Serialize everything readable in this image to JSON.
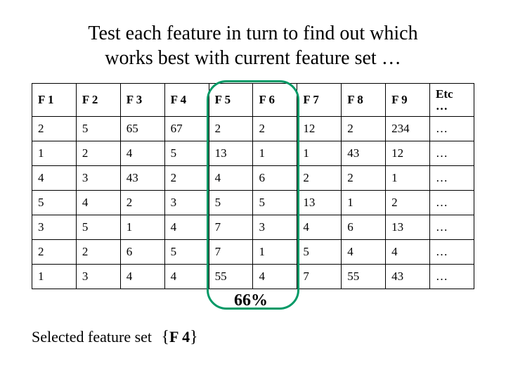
{
  "title_line1": "Test each feature in turn to find out which",
  "title_line2": "works best with current feature set …",
  "headers": [
    "F 1",
    "F 2",
    "F 3",
    "F 4",
    "F 5",
    "F 6",
    "F 7",
    "F 8",
    "F 9"
  ],
  "etc_label": "Etc",
  "etc_dots": "…",
  "rows": [
    [
      "2",
      "5",
      "65",
      "67",
      "2",
      "2",
      "12",
      "2",
      "234",
      "…"
    ],
    [
      "1",
      "2",
      "4",
      "5",
      "13",
      "1",
      "1",
      "43",
      "12",
      "…"
    ],
    [
      "4",
      "3",
      "43",
      "2",
      "4",
      "6",
      "2",
      "2",
      "1",
      "…"
    ],
    [
      "5",
      "4",
      "2",
      "3",
      "5",
      "5",
      "13",
      "1",
      "2",
      "…"
    ],
    [
      "3",
      "5",
      "1",
      "4",
      "7",
      "3",
      "4",
      "6",
      "13",
      "…"
    ],
    [
      "2",
      "2",
      "6",
      "5",
      "7",
      "1",
      "5",
      "4",
      "4",
      "…"
    ],
    [
      "1",
      "3",
      "4",
      "4",
      "55",
      "4",
      "7",
      "55",
      "43",
      "…"
    ]
  ],
  "percent_label": "66%",
  "selected_label": "Selected feature set",
  "selected_brace_open": "{",
  "selected_feature": "F 4",
  "selected_brace_close": "}",
  "chart_data": {
    "type": "table",
    "title": "Test each feature in turn to find out which works best with current feature set …",
    "columns": [
      "F 1",
      "F 2",
      "F 3",
      "F 4",
      "F 5",
      "F 6",
      "F 7",
      "F 8",
      "F 9",
      "Etc"
    ],
    "rows": [
      [
        2,
        5,
        65,
        67,
        2,
        2,
        12,
        2,
        234,
        null
      ],
      [
        1,
        2,
        4,
        5,
        13,
        1,
        1,
        43,
        12,
        null
      ],
      [
        4,
        3,
        43,
        2,
        4,
        6,
        2,
        2,
        1,
        null
      ],
      [
        5,
        4,
        2,
        3,
        5,
        5,
        13,
        1,
        2,
        null
      ],
      [
        3,
        5,
        1,
        4,
        7,
        3,
        4,
        6,
        13,
        null
      ],
      [
        2,
        2,
        6,
        5,
        7,
        1,
        5,
        4,
        4,
        null
      ],
      [
        1,
        3,
        4,
        4,
        55,
        4,
        7,
        55,
        43,
        null
      ]
    ],
    "highlight_columns": [
      "F 5",
      "F 6"
    ],
    "highlight_result_percent": 66,
    "selected_feature_set": [
      "F 4"
    ]
  }
}
